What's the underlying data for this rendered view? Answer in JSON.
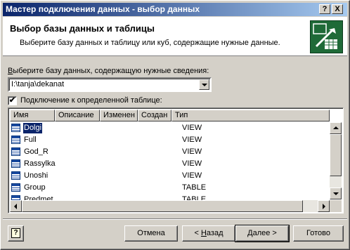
{
  "window": {
    "title": "Мастер подключения данных - выбор данных",
    "help_glyph": "?",
    "close_glyph": "X"
  },
  "header": {
    "title": "Выбор базы данных и таблицы",
    "subtitle": "Выберите базу данных и таблицу или куб, содержащие нужные данные.",
    "icon": "database-connection-wizard-icon"
  },
  "database": {
    "label": "Выберите базу данных, содержащую нужные сведения:",
    "label_accel": "В",
    "label_rest": "ыберите базу данных, содержащую нужные сведения:",
    "value": "I:\\tanja\\dekanat"
  },
  "specific_table": {
    "label": "Подключение к определенной таблице:",
    "checked": true,
    "check_glyph": "✔"
  },
  "table": {
    "columns": [
      "Имя",
      "Описание",
      "Изменен",
      "Создан",
      "Тип"
    ],
    "rows": [
      {
        "name": "Dolgi",
        "type": "VIEW",
        "icon": "view-icon",
        "selected": true
      },
      {
        "name": "Full",
        "type": "VIEW",
        "icon": "view-icon",
        "selected": false
      },
      {
        "name": "God_R",
        "type": "VIEW",
        "icon": "view-icon",
        "selected": false
      },
      {
        "name": "Rassylka",
        "type": "VIEW",
        "icon": "view-icon",
        "selected": false
      },
      {
        "name": "Unoshi",
        "type": "VIEW",
        "icon": "view-icon",
        "selected": false
      },
      {
        "name": "Group",
        "type": "TABLE",
        "icon": "table-icon",
        "selected": false
      },
      {
        "name": "Predmet",
        "type": "TABLE",
        "icon": "table-icon",
        "selected": false
      }
    ]
  },
  "buttons": {
    "help_glyph": "?",
    "cancel": "Отмена",
    "back_prefix": "< ",
    "back_accel": "Н",
    "back_rest": "азад",
    "next_accel": "Д",
    "next_rest": "алее >",
    "finish": "Готово"
  },
  "colors": {
    "title_active": "#0a246a",
    "selection": "#0a246a",
    "face": "#d4d0c8",
    "wizard_icon": "#1f6a38"
  }
}
